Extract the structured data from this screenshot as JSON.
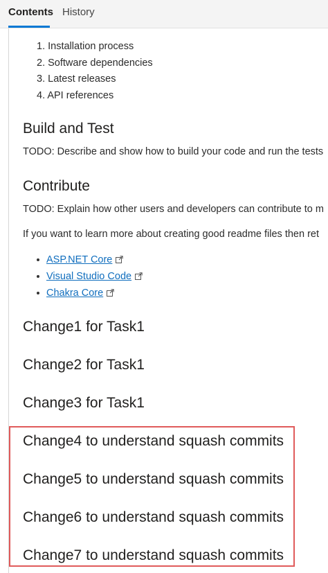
{
  "tabs": [
    {
      "label": "Contents",
      "active": true
    },
    {
      "label": "History",
      "active": false
    }
  ],
  "intro_list": [
    {
      "num": "1.",
      "text": "Installation process"
    },
    {
      "num": "2.",
      "text": "Software dependencies"
    },
    {
      "num": "3.",
      "text": "Latest releases"
    },
    {
      "num": "4.",
      "text": "API references"
    }
  ],
  "build_test": {
    "heading": "Build and Test",
    "text": "TODO: Describe and show how to build your code and run the tests"
  },
  "contribute": {
    "heading": "Contribute",
    "text1": "TODO: Explain how other users and developers can contribute to m",
    "text2": "If you want to learn more about creating good readme files then ret"
  },
  "links": [
    {
      "label": "ASP.NET Core",
      "icon": "external-link-icon"
    },
    {
      "label": "Visual Studio Code",
      "icon": "external-link-icon"
    },
    {
      "label": "Chakra Core",
      "icon": "external-link-icon"
    }
  ],
  "changes": [
    "Change1 for Task1",
    "Change2 for Task1",
    "Change3 for Task1",
    "Change4 to understand squash commits",
    "Change5 to understand squash commits",
    "Change6 to understand squash commits",
    "Change7 to understand squash commits"
  ],
  "colors": {
    "accent": "#0078d4",
    "link": "#106ebe",
    "highlight": "#e05a5a"
  }
}
